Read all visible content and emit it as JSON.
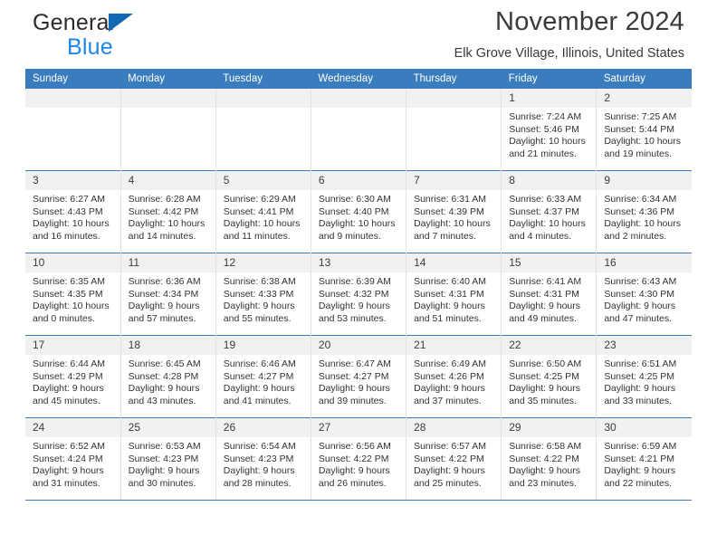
{
  "brand": {
    "line1": "General",
    "line2": "Blue",
    "triangle_color": "#1268b3",
    "blue_color": "#1c85e8"
  },
  "header": {
    "title": "November 2024",
    "subtitle": "Elk Grove Village, Illinois, United States"
  },
  "theme": {
    "header_band": "#3a7dbf",
    "daynum_band": "#f1f1f1",
    "text": "#333333"
  },
  "weekdays": [
    "Sunday",
    "Monday",
    "Tuesday",
    "Wednesday",
    "Thursday",
    "Friday",
    "Saturday"
  ],
  "labels": {
    "sunrise_prefix": "Sunrise: ",
    "sunset_prefix": "Sunset: ",
    "daylight_prefix": "Daylight: "
  },
  "weeks": [
    [
      {
        "day": "",
        "empty": true
      },
      {
        "day": "",
        "empty": true
      },
      {
        "day": "",
        "empty": true
      },
      {
        "day": "",
        "empty": true
      },
      {
        "day": "",
        "empty": true
      },
      {
        "day": "1",
        "sunrise": "Sunrise: 7:24 AM",
        "sunset": "Sunset: 5:46 PM",
        "daylight1": "Daylight: 10 hours",
        "daylight2": "and 21 minutes."
      },
      {
        "day": "2",
        "sunrise": "Sunrise: 7:25 AM",
        "sunset": "Sunset: 5:44 PM",
        "daylight1": "Daylight: 10 hours",
        "daylight2": "and 19 minutes."
      }
    ],
    [
      {
        "day": "3",
        "sunrise": "Sunrise: 6:27 AM",
        "sunset": "Sunset: 4:43 PM",
        "daylight1": "Daylight: 10 hours",
        "daylight2": "and 16 minutes."
      },
      {
        "day": "4",
        "sunrise": "Sunrise: 6:28 AM",
        "sunset": "Sunset: 4:42 PM",
        "daylight1": "Daylight: 10 hours",
        "daylight2": "and 14 minutes."
      },
      {
        "day": "5",
        "sunrise": "Sunrise: 6:29 AM",
        "sunset": "Sunset: 4:41 PM",
        "daylight1": "Daylight: 10 hours",
        "daylight2": "and 11 minutes."
      },
      {
        "day": "6",
        "sunrise": "Sunrise: 6:30 AM",
        "sunset": "Sunset: 4:40 PM",
        "daylight1": "Daylight: 10 hours",
        "daylight2": "and 9 minutes."
      },
      {
        "day": "7",
        "sunrise": "Sunrise: 6:31 AM",
        "sunset": "Sunset: 4:39 PM",
        "daylight1": "Daylight: 10 hours",
        "daylight2": "and 7 minutes."
      },
      {
        "day": "8",
        "sunrise": "Sunrise: 6:33 AM",
        "sunset": "Sunset: 4:37 PM",
        "daylight1": "Daylight: 10 hours",
        "daylight2": "and 4 minutes."
      },
      {
        "day": "9",
        "sunrise": "Sunrise: 6:34 AM",
        "sunset": "Sunset: 4:36 PM",
        "daylight1": "Daylight: 10 hours",
        "daylight2": "and 2 minutes."
      }
    ],
    [
      {
        "day": "10",
        "sunrise": "Sunrise: 6:35 AM",
        "sunset": "Sunset: 4:35 PM",
        "daylight1": "Daylight: 10 hours",
        "daylight2": "and 0 minutes."
      },
      {
        "day": "11",
        "sunrise": "Sunrise: 6:36 AM",
        "sunset": "Sunset: 4:34 PM",
        "daylight1": "Daylight: 9 hours",
        "daylight2": "and 57 minutes."
      },
      {
        "day": "12",
        "sunrise": "Sunrise: 6:38 AM",
        "sunset": "Sunset: 4:33 PM",
        "daylight1": "Daylight: 9 hours",
        "daylight2": "and 55 minutes."
      },
      {
        "day": "13",
        "sunrise": "Sunrise: 6:39 AM",
        "sunset": "Sunset: 4:32 PM",
        "daylight1": "Daylight: 9 hours",
        "daylight2": "and 53 minutes."
      },
      {
        "day": "14",
        "sunrise": "Sunrise: 6:40 AM",
        "sunset": "Sunset: 4:31 PM",
        "daylight1": "Daylight: 9 hours",
        "daylight2": "and 51 minutes."
      },
      {
        "day": "15",
        "sunrise": "Sunrise: 6:41 AM",
        "sunset": "Sunset: 4:31 PM",
        "daylight1": "Daylight: 9 hours",
        "daylight2": "and 49 minutes."
      },
      {
        "day": "16",
        "sunrise": "Sunrise: 6:43 AM",
        "sunset": "Sunset: 4:30 PM",
        "daylight1": "Daylight: 9 hours",
        "daylight2": "and 47 minutes."
      }
    ],
    [
      {
        "day": "17",
        "sunrise": "Sunrise: 6:44 AM",
        "sunset": "Sunset: 4:29 PM",
        "daylight1": "Daylight: 9 hours",
        "daylight2": "and 45 minutes."
      },
      {
        "day": "18",
        "sunrise": "Sunrise: 6:45 AM",
        "sunset": "Sunset: 4:28 PM",
        "daylight1": "Daylight: 9 hours",
        "daylight2": "and 43 minutes."
      },
      {
        "day": "19",
        "sunrise": "Sunrise: 6:46 AM",
        "sunset": "Sunset: 4:27 PM",
        "daylight1": "Daylight: 9 hours",
        "daylight2": "and 41 minutes."
      },
      {
        "day": "20",
        "sunrise": "Sunrise: 6:47 AM",
        "sunset": "Sunset: 4:27 PM",
        "daylight1": "Daylight: 9 hours",
        "daylight2": "and 39 minutes."
      },
      {
        "day": "21",
        "sunrise": "Sunrise: 6:49 AM",
        "sunset": "Sunset: 4:26 PM",
        "daylight1": "Daylight: 9 hours",
        "daylight2": "and 37 minutes."
      },
      {
        "day": "22",
        "sunrise": "Sunrise: 6:50 AM",
        "sunset": "Sunset: 4:25 PM",
        "daylight1": "Daylight: 9 hours",
        "daylight2": "and 35 minutes."
      },
      {
        "day": "23",
        "sunrise": "Sunrise: 6:51 AM",
        "sunset": "Sunset: 4:25 PM",
        "daylight1": "Daylight: 9 hours",
        "daylight2": "and 33 minutes."
      }
    ],
    [
      {
        "day": "24",
        "sunrise": "Sunrise: 6:52 AM",
        "sunset": "Sunset: 4:24 PM",
        "daylight1": "Daylight: 9 hours",
        "daylight2": "and 31 minutes."
      },
      {
        "day": "25",
        "sunrise": "Sunrise: 6:53 AM",
        "sunset": "Sunset: 4:23 PM",
        "daylight1": "Daylight: 9 hours",
        "daylight2": "and 30 minutes."
      },
      {
        "day": "26",
        "sunrise": "Sunrise: 6:54 AM",
        "sunset": "Sunset: 4:23 PM",
        "daylight1": "Daylight: 9 hours",
        "daylight2": "and 28 minutes."
      },
      {
        "day": "27",
        "sunrise": "Sunrise: 6:56 AM",
        "sunset": "Sunset: 4:22 PM",
        "daylight1": "Daylight: 9 hours",
        "daylight2": "and 26 minutes."
      },
      {
        "day": "28",
        "sunrise": "Sunrise: 6:57 AM",
        "sunset": "Sunset: 4:22 PM",
        "daylight1": "Daylight: 9 hours",
        "daylight2": "and 25 minutes."
      },
      {
        "day": "29",
        "sunrise": "Sunrise: 6:58 AM",
        "sunset": "Sunset: 4:22 PM",
        "daylight1": "Daylight: 9 hours",
        "daylight2": "and 23 minutes."
      },
      {
        "day": "30",
        "sunrise": "Sunrise: 6:59 AM",
        "sunset": "Sunset: 4:21 PM",
        "daylight1": "Daylight: 9 hours",
        "daylight2": "and 22 minutes."
      }
    ]
  ]
}
